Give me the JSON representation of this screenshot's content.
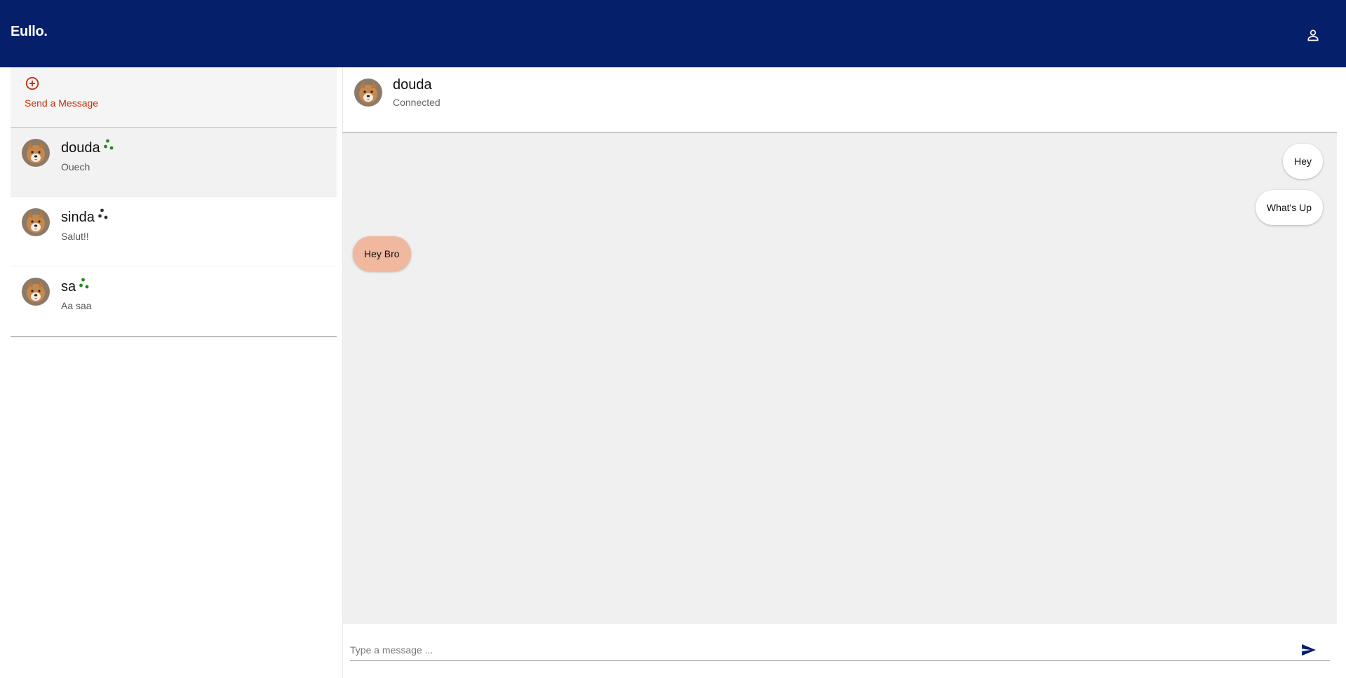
{
  "app": {
    "brand": "Eullo."
  },
  "colors": {
    "topbar": "#061f6b",
    "accent": "#c62d0a",
    "online": "#1f8a1f",
    "offline": "#333333",
    "incoming_bubble": "#f0b89e"
  },
  "header": {
    "account_icon": "person-outline-icon"
  },
  "sidebar": {
    "new_message": {
      "icon": "add-circle-outline-icon",
      "label": "Send a Message"
    },
    "conversations": [
      {
        "name": "douda",
        "preview": "Ouech",
        "online": true,
        "active": true
      },
      {
        "name": "sinda",
        "preview": "Salut!!",
        "online": false,
        "active": false
      },
      {
        "name": "sa",
        "preview": "Aa saa",
        "online": true,
        "active": false
      }
    ]
  },
  "chat": {
    "title": "douda",
    "status": "Connected",
    "messages": [
      {
        "text": "Hey",
        "direction": "out"
      },
      {
        "text": "What's Up",
        "direction": "out"
      },
      {
        "text": "Hey Bro",
        "direction": "in"
      }
    ],
    "composer": {
      "placeholder": "Type a message ...",
      "send_icon": "send-icon"
    }
  }
}
